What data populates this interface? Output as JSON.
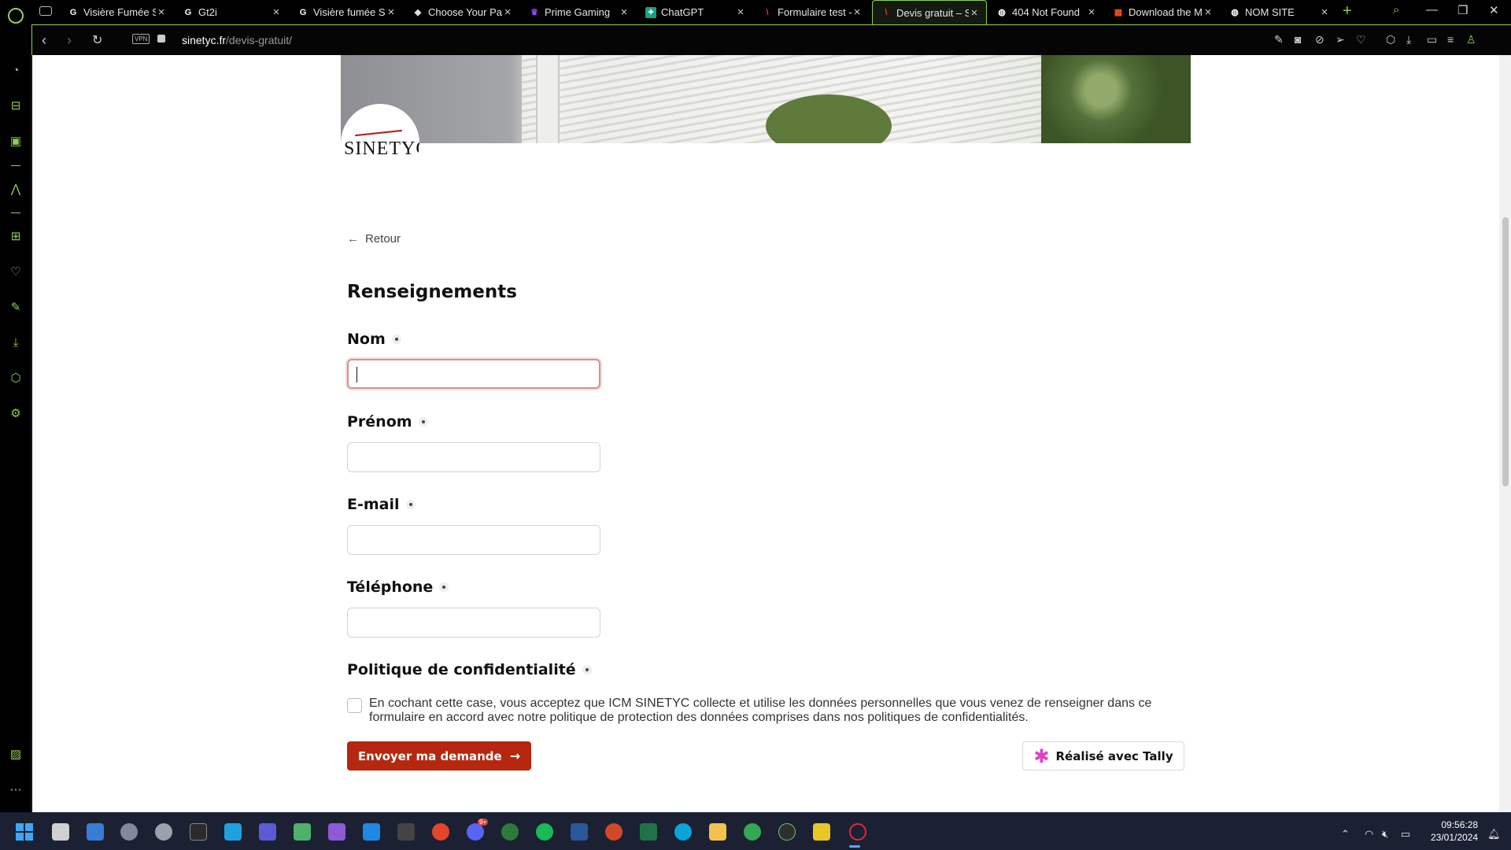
{
  "browser": {
    "tabs": [
      {
        "title": "Visière Fumée Sp",
        "favicon": "G",
        "fav_color": "#ffffff",
        "fav_bg": "transparent"
      },
      {
        "title": "Gt2i",
        "favicon": "G",
        "fav_color": "#ffffff",
        "fav_bg": "transparent"
      },
      {
        "title": "Visière fumée Sp",
        "favicon": "G",
        "fav_color": "#ffffff",
        "fav_bg": "transparent"
      },
      {
        "title": "Choose Your Part",
        "favicon": "◆",
        "fav_color": "#dddddd",
        "fav_bg": "transparent"
      },
      {
        "title": "Prime Gaming",
        "favicon": "♛",
        "fav_color": "#9146ff",
        "fav_bg": "transparent"
      },
      {
        "title": "ChatGPT",
        "favicon": "✦",
        "fav_color": "#ffffff",
        "fav_bg": "#10a37f"
      },
      {
        "title": "Formulaire test -",
        "favicon": "\\",
        "fav_color": "#e0382a",
        "fav_bg": "transparent"
      },
      {
        "title": "Devis gratuit – Sin",
        "favicon": "\\",
        "fav_color": "#e0382a",
        "fav_bg": "transparent"
      },
      {
        "title": "404 Not Found",
        "favicon": "◍",
        "fav_color": "#ffffff",
        "fav_bg": "transparent"
      },
      {
        "title": "Download the Mi",
        "favicon": "▦",
        "fav_color": "#f25022",
        "fav_bg": "transparent"
      },
      {
        "title": "NOM SITE",
        "favicon": "◍",
        "fav_color": "#ffffff",
        "fav_bg": "transparent"
      }
    ],
    "active_tab_index": 7,
    "address": {
      "domain": "sinetyc.fr",
      "path": "/devis-gratuit/"
    },
    "vpn_label": "VPN",
    "accent": "#8fd14f"
  },
  "page": {
    "logo_text": "SINETYC",
    "back_label": "Retour",
    "section_title": "Renseignements",
    "fields": [
      {
        "label": "Nom",
        "value": ""
      },
      {
        "label": "Prénom",
        "value": ""
      },
      {
        "label": "E-mail",
        "value": ""
      },
      {
        "label": "Téléphone",
        "value": ""
      }
    ],
    "privacy_title": "Politique de confidentialité",
    "consent_text": "En cochant cette case, vous acceptez que ICM SINETYC collecte et utilise les données personnelles que vous venez de renseigner dans ce formulaire en accord avec notre politique de protection des données comprises dans nos politiques de confidentialités.",
    "submit_label": "Envoyer ma demande",
    "tally_label": "Réalisé avec Tally",
    "button_color": "#b5280f"
  },
  "taskbar": {
    "time": "09:56:28",
    "date": "23/01/2024",
    "discord_badge": "9+"
  }
}
